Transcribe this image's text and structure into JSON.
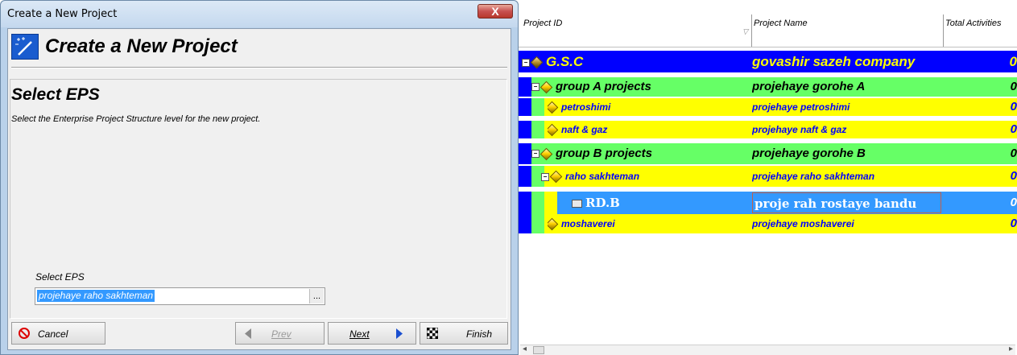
{
  "dialog": {
    "window_title": "Create a New Project",
    "close_glyph": "X",
    "header_title": "Create a New Project",
    "section_title": "Select EPS",
    "section_desc": "Select the Enterprise Project Structure level for the new project.",
    "eps_label": "Select EPS",
    "eps_value": "projehaye raho sakhteman",
    "browse_glyph": "...",
    "buttons": {
      "cancel": "Cancel",
      "prev": "Prev",
      "next": "Next",
      "finish": "Finish"
    }
  },
  "grid": {
    "columns": [
      "Project ID",
      "Project Name",
      "Total Activities"
    ],
    "rows": [
      {
        "id": "G.S.C",
        "name": "govashir sazeh company",
        "total": "0",
        "level": 0,
        "kind": "eps",
        "expanded": true
      },
      {
        "id": "group A projects",
        "name": "projehaye gorohe A",
        "total": "0",
        "level": 1,
        "kind": "eps",
        "expanded": true
      },
      {
        "id": "petroshimi",
        "name": "projehaye petroshimi",
        "total": "0",
        "level": 2,
        "kind": "eps"
      },
      {
        "id": "naft & gaz",
        "name": "projehaye naft & gaz",
        "total": "0",
        "level": 2,
        "kind": "eps"
      },
      {
        "id": "group B projects",
        "name": "projehaye gorohe B",
        "total": "0",
        "level": 1,
        "kind": "eps",
        "expanded": true
      },
      {
        "id": "raho sakhteman",
        "name": "projehaye raho sakhteman",
        "total": "0",
        "level": 2,
        "kind": "eps",
        "expanded": true
      },
      {
        "id": "RD.B",
        "name": "proje rah rostaye bandu",
        "total": "0",
        "level": 3,
        "kind": "project",
        "selected": true
      },
      {
        "id": "moshaverei",
        "name": "projehaye moshaverei",
        "total": "0",
        "level": 2,
        "kind": "eps"
      }
    ],
    "colors": {
      "level0_bg": "#0000ff",
      "level0_text": "#ffff00",
      "level1_bg": "#66ff66",
      "level2_bg": "#ffff00",
      "level2_text": "#0000ff",
      "selected_bg": "#3399ff",
      "selected_text": "#ffffff"
    }
  }
}
